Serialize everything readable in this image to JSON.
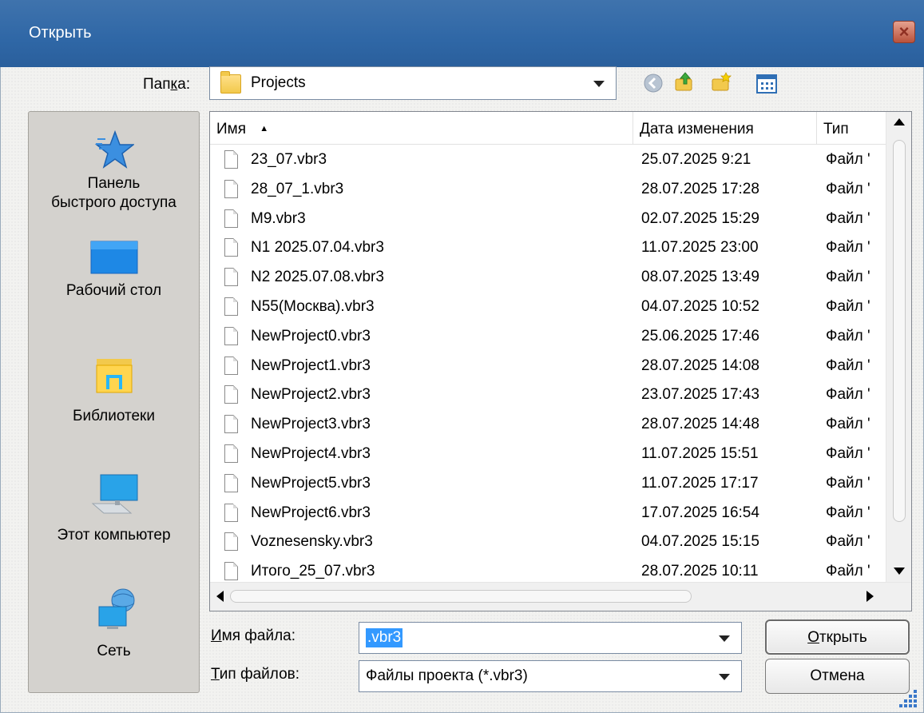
{
  "window": {
    "title": "Открыть"
  },
  "folder_bar": {
    "label_pre": "Пап",
    "label_accel": "к",
    "label_post": "а:",
    "current": "Projects",
    "icons": [
      "back-icon",
      "up-folder-icon",
      "new-folder-icon",
      "view-menu-icon"
    ]
  },
  "places": [
    {
      "id": "quick-access",
      "icon": "star-icon",
      "line1": "Панель",
      "line2": "быстрого доступа"
    },
    {
      "id": "desktop",
      "icon": "desktop-icon",
      "line1": "Рабочий стол",
      "line2": ""
    },
    {
      "id": "libraries",
      "icon": "libraries-icon",
      "line1": "Библиотеки",
      "line2": ""
    },
    {
      "id": "this-pc",
      "icon": "computer-icon",
      "line1": "Этот компьютер",
      "line2": ""
    },
    {
      "id": "network",
      "icon": "network-icon",
      "line1": "Сеть",
      "line2": ""
    }
  ],
  "file_list": {
    "columns": [
      "Имя",
      "Дата изменения",
      "Тип"
    ],
    "sort_indicator": "▲",
    "files": [
      {
        "name": "23_07.vbr3",
        "date": "25.07.2025 9:21",
        "type": "Файл '"
      },
      {
        "name": "28_07_1.vbr3",
        "date": "28.07.2025 17:28",
        "type": "Файл '"
      },
      {
        "name": "M9.vbr3",
        "date": "02.07.2025 15:29",
        "type": "Файл '"
      },
      {
        "name": "N1 2025.07.04.vbr3",
        "date": "11.07.2025 23:00",
        "type": "Файл '"
      },
      {
        "name": "N2 2025.07.08.vbr3",
        "date": "08.07.2025 13:49",
        "type": "Файл '"
      },
      {
        "name": "N55(Москва).vbr3",
        "date": "04.07.2025 10:52",
        "type": "Файл '"
      },
      {
        "name": "NewProject0.vbr3",
        "date": "25.06.2025 17:46",
        "type": "Файл '"
      },
      {
        "name": "NewProject1.vbr3",
        "date": "28.07.2025 14:08",
        "type": "Файл '"
      },
      {
        "name": "NewProject2.vbr3",
        "date": "23.07.2025 17:43",
        "type": "Файл '"
      },
      {
        "name": "NewProject3.vbr3",
        "date": "28.07.2025 14:48",
        "type": "Файл '"
      },
      {
        "name": "NewProject4.vbr3",
        "date": "11.07.2025 15:51",
        "type": "Файл '"
      },
      {
        "name": "NewProject5.vbr3",
        "date": "11.07.2025 17:17",
        "type": "Файл '"
      },
      {
        "name": "NewProject6.vbr3",
        "date": "17.07.2025 16:54",
        "type": "Файл '"
      },
      {
        "name": "Voznesensky.vbr3",
        "date": "04.07.2025 15:15",
        "type": "Файл '"
      },
      {
        "name": "Итого_25_07.vbr3",
        "date": "28.07.2025 10:11",
        "type": "Файл '"
      }
    ]
  },
  "filename": {
    "label_accel": "И",
    "label_post": "мя файла:",
    "value": ".vbr3"
  },
  "filetype": {
    "label_accel": "Т",
    "label_post": "ип файлов:",
    "value": "Файлы проекта (*.vbr3)"
  },
  "buttons": {
    "open_accel": "О",
    "open_rest": "ткрыть",
    "cancel": "Отмена"
  },
  "colors": {
    "titlebar": "#2f67a6",
    "selection": "#3399ff"
  }
}
